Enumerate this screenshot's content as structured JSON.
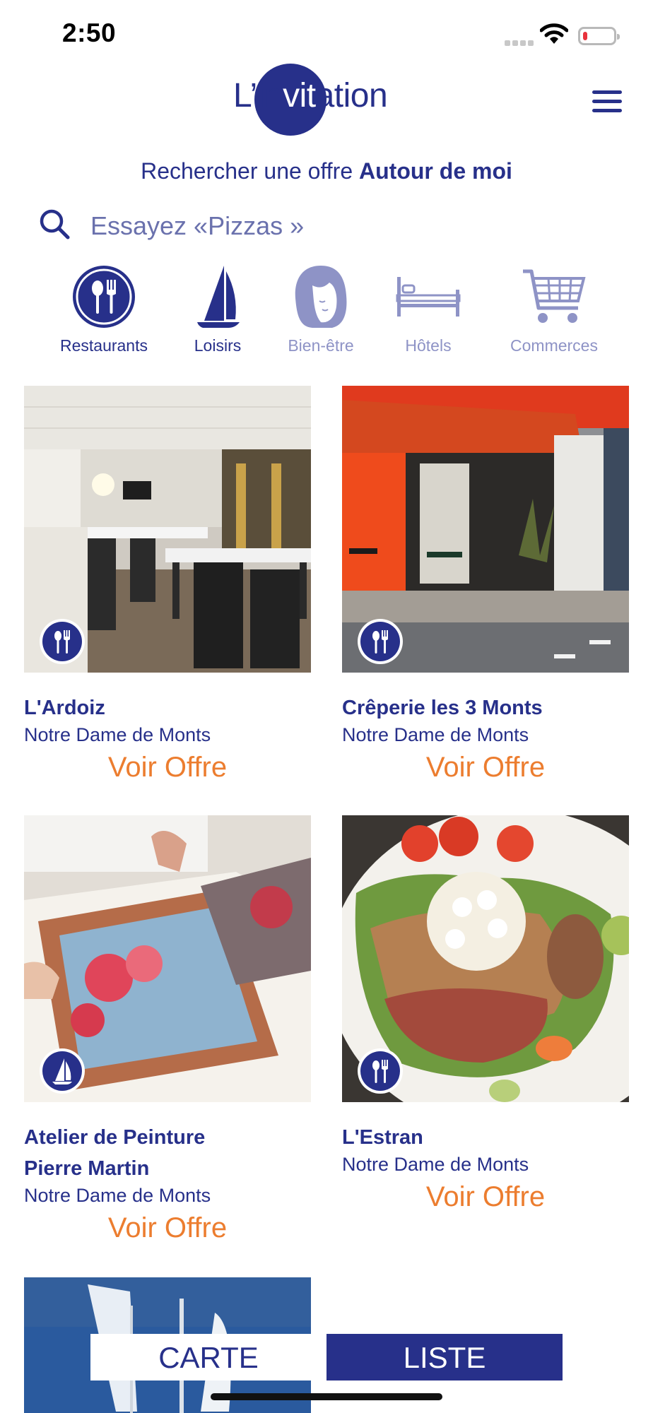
{
  "status_bar": {
    "time": "2:50"
  },
  "header": {
    "logo_text": {
      "a": "L’in",
      "b": "vit",
      "c": "ation"
    },
    "menu_icon": "hamburger-icon"
  },
  "search": {
    "heading_prefix": "Rechercher une offre ",
    "heading_bold": "Autour de moi",
    "placeholder": "Essayez «Pizzas »"
  },
  "categories": [
    {
      "label": "Restaurants",
      "icon": "restaurant-icon",
      "active": true
    },
    {
      "label": "Loisirs",
      "icon": "sailboat-icon",
      "active": true
    },
    {
      "label": "Bien-être",
      "icon": "face-icon",
      "active": false
    },
    {
      "label": "Hôtels",
      "icon": "bed-icon",
      "active": false
    },
    {
      "label": "Commerces",
      "icon": "cart-icon",
      "active": false
    }
  ],
  "cards": [
    {
      "title": "L'Ardoiz",
      "city": "Notre Dame de Monts",
      "cta": "Voir Offre",
      "category_icon": "restaurant-icon"
    },
    {
      "title": "Crêperie les 3 Monts",
      "city": "Notre Dame de Monts",
      "cta": "Voir Offre",
      "category_icon": "restaurant-icon"
    },
    {
      "title_line1": "Atelier de Peinture",
      "title_line2": "Pierre Martin",
      "city": "Notre Dame de Monts",
      "cta": "Voir Offre",
      "category_icon": "sailboat-icon"
    },
    {
      "title": "L'Estran",
      "city": "Notre Dame de Monts",
      "cta": "Voir Offre",
      "category_icon": "restaurant-icon"
    }
  ],
  "view_toggle": {
    "map_label": "CARTE",
    "list_label": "LISTE",
    "selected": "LISTE"
  },
  "colors": {
    "brand": "#27308a",
    "accent": "#ec7d2f",
    "muted": "#8e93c6"
  }
}
